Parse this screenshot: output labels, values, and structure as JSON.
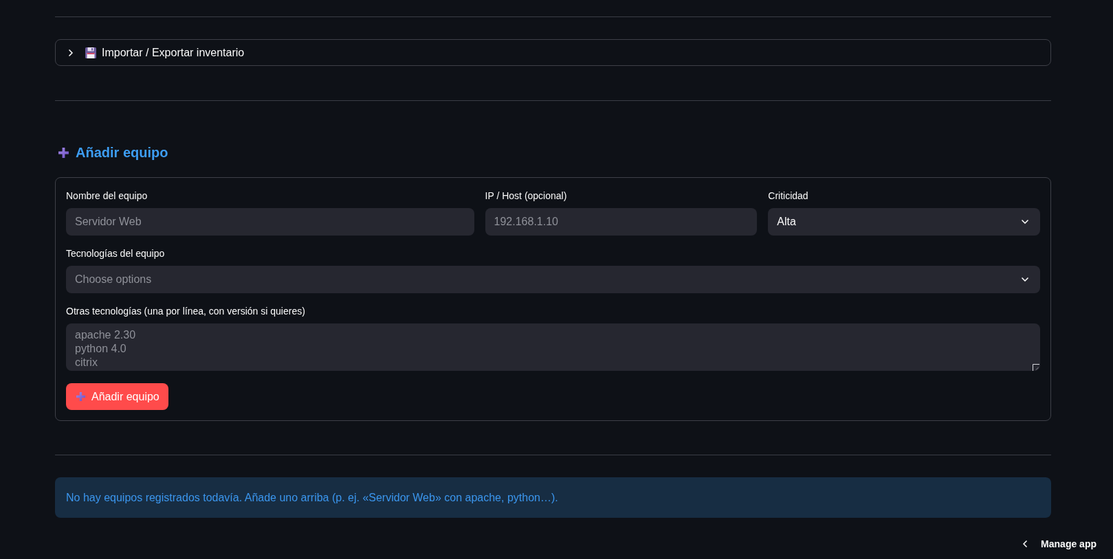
{
  "expander": {
    "label": "Importar / Exportar inventario",
    "expanded": false
  },
  "add_section": {
    "heading": "Añadir equipo"
  },
  "form": {
    "rows": [
      {
        "fields": [
          {
            "kind": "text",
            "label": "Nombre del equipo",
            "placeholder": "Servidor Web"
          },
          {
            "kind": "text",
            "label": "IP / Host (opcional)",
            "placeholder": "192.168.1.10"
          },
          {
            "kind": "select",
            "label": "Criticidad",
            "value": "Alta"
          }
        ]
      },
      {
        "fields": [
          {
            "kind": "multiselect",
            "label": "Tecnologías del equipo",
            "placeholder": "Choose options"
          }
        ]
      },
      {
        "fields": [
          {
            "kind": "textarea",
            "label": "Otras tecnologías (una por línea, con versión si quieres)",
            "placeholder": "apache 2.30\npython 4.0\ncitrix"
          }
        ]
      }
    ],
    "submit_button": {
      "label": "Añadir equipo"
    }
  },
  "info_box": {
    "text": "No hay equipos registrados todavía. Añade uno arriba (p. ej. «Servidor Web» con apache, python…)."
  },
  "manage_app": {
    "label": "Manage app"
  }
}
